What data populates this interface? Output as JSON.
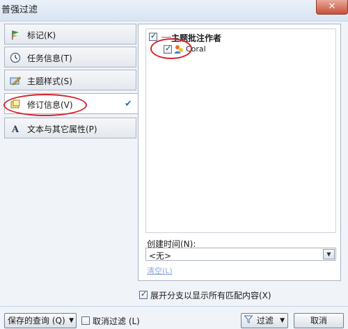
{
  "window": {
    "title": "普强过滤",
    "close_glyph": "✕"
  },
  "categories": [
    {
      "label": "标记(K)",
      "icon": "flag-icon"
    },
    {
      "label": "任务信息(T)",
      "icon": "clock-icon"
    },
    {
      "label": "主题样式(S)",
      "icon": "pencil-icon"
    },
    {
      "label": "修订信息(V)",
      "icon": "revision-icon",
      "active": true
    },
    {
      "label": "文本与其它属性(P)",
      "icon": "text-a-icon"
    }
  ],
  "tree": {
    "header": "主题批注作者",
    "child": "Coral"
  },
  "created_time": {
    "label": "创建时间(N):",
    "value": "<无>"
  },
  "clear_label": "清空(L)",
  "expand_label": "展开分支以显示所有匹配内容(X)",
  "buttons": {
    "saved_query": "保存的查询 (Q)",
    "cancel_filter": "取消过滤 (L)",
    "filter": "过滤",
    "cancel": "取消"
  },
  "colors": {
    "accent": "#2f6fbf",
    "annotation_red": "#d8222b"
  }
}
